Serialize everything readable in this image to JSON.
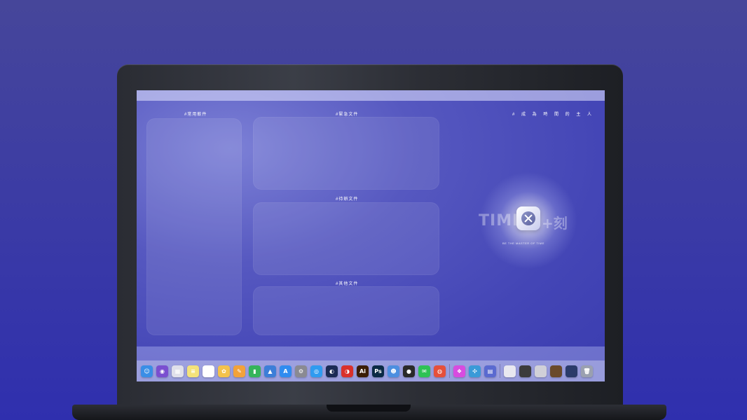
{
  "sections": {
    "common_software": "#常用軟件",
    "urgent_files": "#緊急文件",
    "pending_files": "#待辦文件",
    "other_files": "#其他文件"
  },
  "slogan": "# 成 為 時 間 的 主 人",
  "logo": {
    "left_text": "TIME",
    "right_text": "+刻",
    "tagline": "BE THE MASTER OF TIME"
  },
  "dock_icons": [
    {
      "name": "finder-icon",
      "color": "#3a8ee6",
      "glyph": "☺"
    },
    {
      "name": "siri-icon",
      "color": "#7a4fd0",
      "glyph": "◉"
    },
    {
      "name": "launchpad-icon",
      "color": "#e0e0ea",
      "glyph": "▦"
    },
    {
      "name": "notes-icon",
      "color": "#f4e27a",
      "glyph": "≡"
    },
    {
      "name": "reminders-icon",
      "color": "#ffffff",
      "glyph": "☰"
    },
    {
      "name": "photos-icon",
      "color": "#f3c24b",
      "glyph": "✿"
    },
    {
      "name": "pages-icon",
      "color": "#f2a23a",
      "glyph": "✎"
    },
    {
      "name": "numbers-icon",
      "color": "#35b45a",
      "glyph": "▮"
    },
    {
      "name": "keynote-icon",
      "color": "#3c7ed8",
      "glyph": "▲"
    },
    {
      "name": "app-store-icon",
      "color": "#2f8cf0",
      "glyph": "A"
    },
    {
      "name": "system-preferences-icon",
      "color": "#8a8a92",
      "glyph": "⚙"
    },
    {
      "name": "safari-icon",
      "color": "#2f9bf0",
      "glyph": "◎"
    },
    {
      "name": "cinema4d-icon",
      "color": "#1b2b55",
      "glyph": "◐"
    },
    {
      "name": "netease-music-icon",
      "color": "#d9312b",
      "glyph": "◑"
    },
    {
      "name": "illustrator-icon",
      "color": "#3a1e06",
      "glyph": "Ai"
    },
    {
      "name": "photoshop-icon",
      "color": "#0b2a45",
      "glyph": "Ps"
    },
    {
      "name": "finder-alt-icon",
      "color": "#4d8fe0",
      "glyph": "☻"
    },
    {
      "name": "qq-icon",
      "color": "#2a2a2a",
      "glyph": "●"
    },
    {
      "name": "wechat-icon",
      "color": "#2ec254",
      "glyph": "✉"
    },
    {
      "name": "chrome-icon",
      "color": "#e5503b",
      "glyph": "◍"
    },
    {
      "name": "sep"
    },
    {
      "name": "app-icon-a",
      "color": "#d84be0",
      "glyph": "❖"
    },
    {
      "name": "app-icon-b",
      "color": "#3a9ad8",
      "glyph": "✣"
    },
    {
      "name": "app-icon-c",
      "color": "#5a6ad0",
      "glyph": "▤"
    },
    {
      "name": "sep"
    },
    {
      "name": "window-thumb-1-icon",
      "color": "#e8e8f0",
      "glyph": ""
    },
    {
      "name": "window-thumb-2-icon",
      "color": "#3b3b3b",
      "glyph": ""
    },
    {
      "name": "window-thumb-3-icon",
      "color": "#d0d0d8",
      "glyph": ""
    },
    {
      "name": "window-thumb-4-icon",
      "color": "#6a4a2a",
      "glyph": ""
    },
    {
      "name": "window-thumb-5-icon",
      "color": "#2b3b6a",
      "glyph": ""
    },
    {
      "name": "trash-icon",
      "color": "#9aa0b0",
      "glyph": "🗑"
    }
  ]
}
